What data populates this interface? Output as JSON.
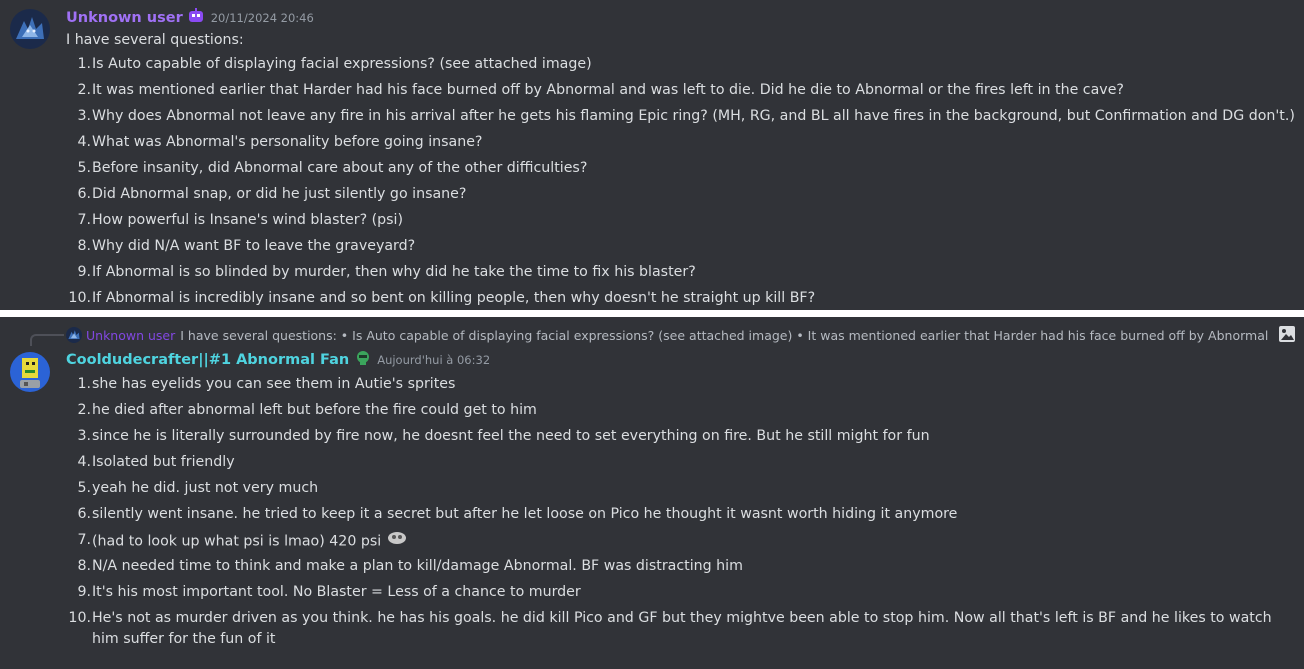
{
  "message1": {
    "username": "Unknown user",
    "username_color": "#a071f5",
    "timestamp": "20/11/2024 20:46",
    "intro": "I have several questions:",
    "items": [
      {
        "n": "1.",
        "text": "Is Auto capable of displaying facial expressions? (see attached image)"
      },
      {
        "n": "2.",
        "text": "It was mentioned earlier that Harder had his face burned off by Abnormal and was left to die. Did he die to Abnormal or the fires left in the cave?"
      },
      {
        "n": "3.",
        "text": "Why does Abnormal not leave any fire in his arrival after he gets his flaming Epic ring? (MH, RG, and BL all have fires in the background, but Confirmation and DG don't.)"
      },
      {
        "n": "4.",
        "text": "What was Abnormal's personality before going insane?"
      },
      {
        "n": "5.",
        "text": "Before insanity, did Abnormal care about any of the other difficulties?"
      },
      {
        "n": "6.",
        "text": "Did Abnormal snap, or did he just silently go insane?"
      },
      {
        "n": "7.",
        "text": "How powerful is Insane's wind blaster? (psi)"
      },
      {
        "n": "8.",
        "text": "Why did N/A want BF to leave the graveyard?"
      },
      {
        "n": "9.",
        "text": "If Abnormal is so blinded by murder, then why did he take the time to fix his blaster?"
      },
      {
        "n": "10.",
        "text": "If Abnormal is incredibly insane and so bent on killing people, then why doesn't he straight up kill BF?"
      }
    ]
  },
  "message2": {
    "reply": {
      "username": "Unknown user",
      "text": "I have several questions: • Is Auto capable of displaying facial expressions? (see attached image)  • It was mentioned earlier that Harder had his face burned off by Abnormal and was lef…"
    },
    "username": "Cooldudecrafter||#1 Abnormal Fan",
    "username_color": "#4fd4e0",
    "timestamp": "Aujourd'hui à 06:32",
    "items": [
      {
        "n": "1.",
        "text": "she has eyelids you can see them in Autie's sprites"
      },
      {
        "n": "2.",
        "text": "he died after abnormal left but before the fire could get to him"
      },
      {
        "n": "3.",
        "text": "since he is literally surrounded by fire now, he doesnt feel the need to set everything on fire. But he still might for fun"
      },
      {
        "n": "4.",
        "text": "Isolated but friendly"
      },
      {
        "n": "5.",
        "text": "yeah he did. just not very much"
      },
      {
        "n": "6.",
        "text": "silently went insane. he tried to keep it a secret but after he let loose on Pico he thought it wasnt worth hiding it anymore"
      },
      {
        "n": "7.",
        "text": "(had to look up what psi is lmao) 420 psi"
      },
      {
        "n": "8.",
        "text": "N/A needed time to think and make a plan to kill/damage Abnormal. BF was distracting him"
      },
      {
        "n": "9.",
        "text": "It's his most important tool. No Blaster = Less of a chance to murder"
      },
      {
        "n": "10.",
        "text": "He's not as murder driven as you think. he has his goals. he did kill Pico and GF but they mightve been able to stop him. Now all that's left is BF and he likes to watch him suffer for the fun of it"
      }
    ]
  },
  "icons": {
    "avatar1": "dragon-avatar-icon",
    "avatar2": "robot-avatar-icon",
    "badge1": "purple-robot-badge-icon",
    "badge2": "green-helmet-badge-icon",
    "reply_image": "image-icon",
    "emoji": "skull-emoji-icon"
  }
}
